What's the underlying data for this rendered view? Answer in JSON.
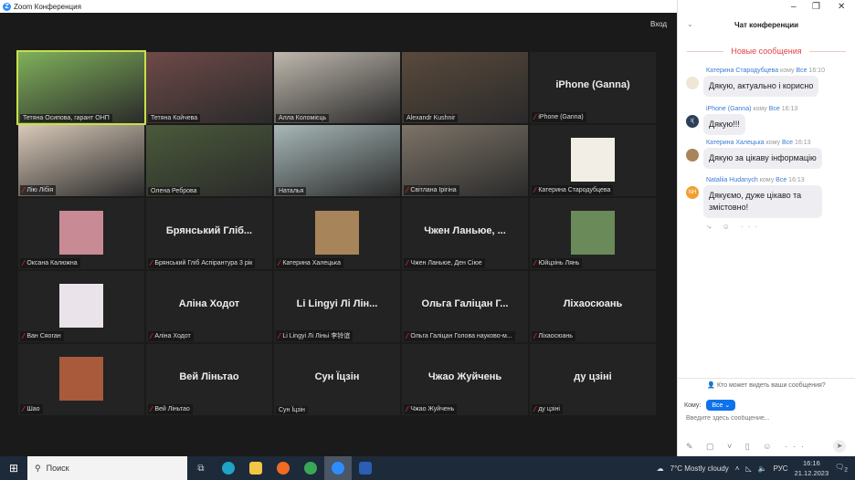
{
  "window": {
    "title": "Zoom Конференция",
    "enter": "Вход"
  },
  "tiles": [
    {
      "label": "Тетяна Осипова, гарант ОНП",
      "type": "video",
      "muted": false,
      "color": "#7fb05a",
      "active": true
    },
    {
      "label": "Тетяна Койчева",
      "type": "video",
      "muted": false,
      "color": "#6e4a48"
    },
    {
      "label": "Алла Коломієць",
      "type": "video",
      "muted": false,
      "color": "#bfb8ae"
    },
    {
      "label": "Alexandr Kushnir",
      "type": "video",
      "muted": false,
      "color": "#5a4a3c"
    },
    {
      "label": "iPhone (Ganna)",
      "big": "iPhone (Ganna)",
      "type": "name",
      "muted": true
    },
    {
      "label": "Лію  Лібія",
      "type": "video",
      "muted": true,
      "color": "#d8c9b8"
    },
    {
      "label": "Олена Реброва",
      "type": "video",
      "muted": false,
      "color": "#4a5a3a"
    },
    {
      "label": "Наталья",
      "type": "video",
      "muted": false,
      "color": "#a8b8b8"
    },
    {
      "label": "Світлана Ірігіна",
      "type": "video",
      "muted": true,
      "color": "#7d7468"
    },
    {
      "label": "Катерина Стародубцева",
      "type": "avatar",
      "muted": true,
      "color": "#f2eee6"
    },
    {
      "label": "Оксана Калюжна",
      "type": "avatar",
      "muted": true,
      "color": "#c88a94"
    },
    {
      "label": "Брянський Гліб Аспірантура 3 рік",
      "big": "Брянський  Гліб...",
      "type": "name",
      "muted": true
    },
    {
      "label": "Катерина Халецька",
      "type": "avatar",
      "muted": true,
      "color": "#a8845a"
    },
    {
      "label": "Чжен Ланьюе,  Ден Сіюе",
      "big": "Чжен  Ланьюе,  ...",
      "type": "name",
      "muted": true
    },
    {
      "label": "Юйцзінь Лянь",
      "type": "avatar",
      "muted": true,
      "color": "#6a8a5a"
    },
    {
      "label": "Ван Сяоган",
      "type": "avatar",
      "muted": true,
      "color": "#eae4ea"
    },
    {
      "label": "Аліна Ходот",
      "big": "Аліна Ходот",
      "type": "name",
      "muted": true
    },
    {
      "label": "Li Lingyi  Лі Ліньі 李铃谊",
      "big": "Li Lingyi  Лі Лін...",
      "type": "name",
      "muted": true
    },
    {
      "label": "Ольга Галіцан Голова науково-м...",
      "big": "Ольга  Галіцан  Г...",
      "type": "name",
      "muted": true
    },
    {
      "label": "Ліхаосюань",
      "big": "Ліхаосюань",
      "type": "name",
      "muted": true
    },
    {
      "label": "Шао",
      "type": "avatar",
      "muted": true,
      "color": "#a85a3a"
    },
    {
      "label": "Вей Ліньтао",
      "big": "Вей Ліньтао",
      "type": "name",
      "muted": true
    },
    {
      "label": "Сун Їцзін",
      "big": "Сун Їцзін",
      "type": "name",
      "muted": false
    },
    {
      "label": "Чжао Жуйчень",
      "big": "Чжао Жуйчень",
      "type": "name",
      "muted": true
    },
    {
      "label": "ду цзіні",
      "big": "ду цзіні",
      "type": "name",
      "muted": true
    }
  ],
  "chat": {
    "title": "Чат конференции",
    "new_messages": "Новые сообщения",
    "messages": [
      {
        "sender": "Катерина Стародубцева",
        "to_word": "кому",
        "to": "Все",
        "time": "16:10",
        "text": "Дякую, актуально і корисно",
        "avatar": "",
        "avatar_color": "#efe6d6"
      },
      {
        "sender": "iPhone (Ganna)",
        "to_word": "кому",
        "to": "Все",
        "time": "16:13",
        "text": "Дякую!!!",
        "avatar": "I(",
        "avatar_color": "#2c3e5a"
      },
      {
        "sender": "Катерина Халецька",
        "to_word": "кому",
        "to": "Все",
        "time": "16:13",
        "text": "Дякую за цікаву інформацію",
        "avatar": "",
        "avatar_color": "#a8845a"
      },
      {
        "sender": "Nataliia Hudanych",
        "to_word": "кому",
        "to": "Все",
        "time": "16:13",
        "text": "Дякуємо, дуже цікаво та змістовно!",
        "avatar": "NH",
        "avatar_color": "#f0a030"
      }
    ],
    "who_can_see": "Кто может видеть ваши сообщения?",
    "to_label": "Кому:",
    "to_value": "Все",
    "placeholder": "Введите здесь сообщение..."
  },
  "taskbar": {
    "search": "Поиск",
    "weather": "7°C  Mostly cloudy",
    "lang": "РУС",
    "time": "16:16",
    "date": "21.12.2023",
    "notifications": "2"
  }
}
